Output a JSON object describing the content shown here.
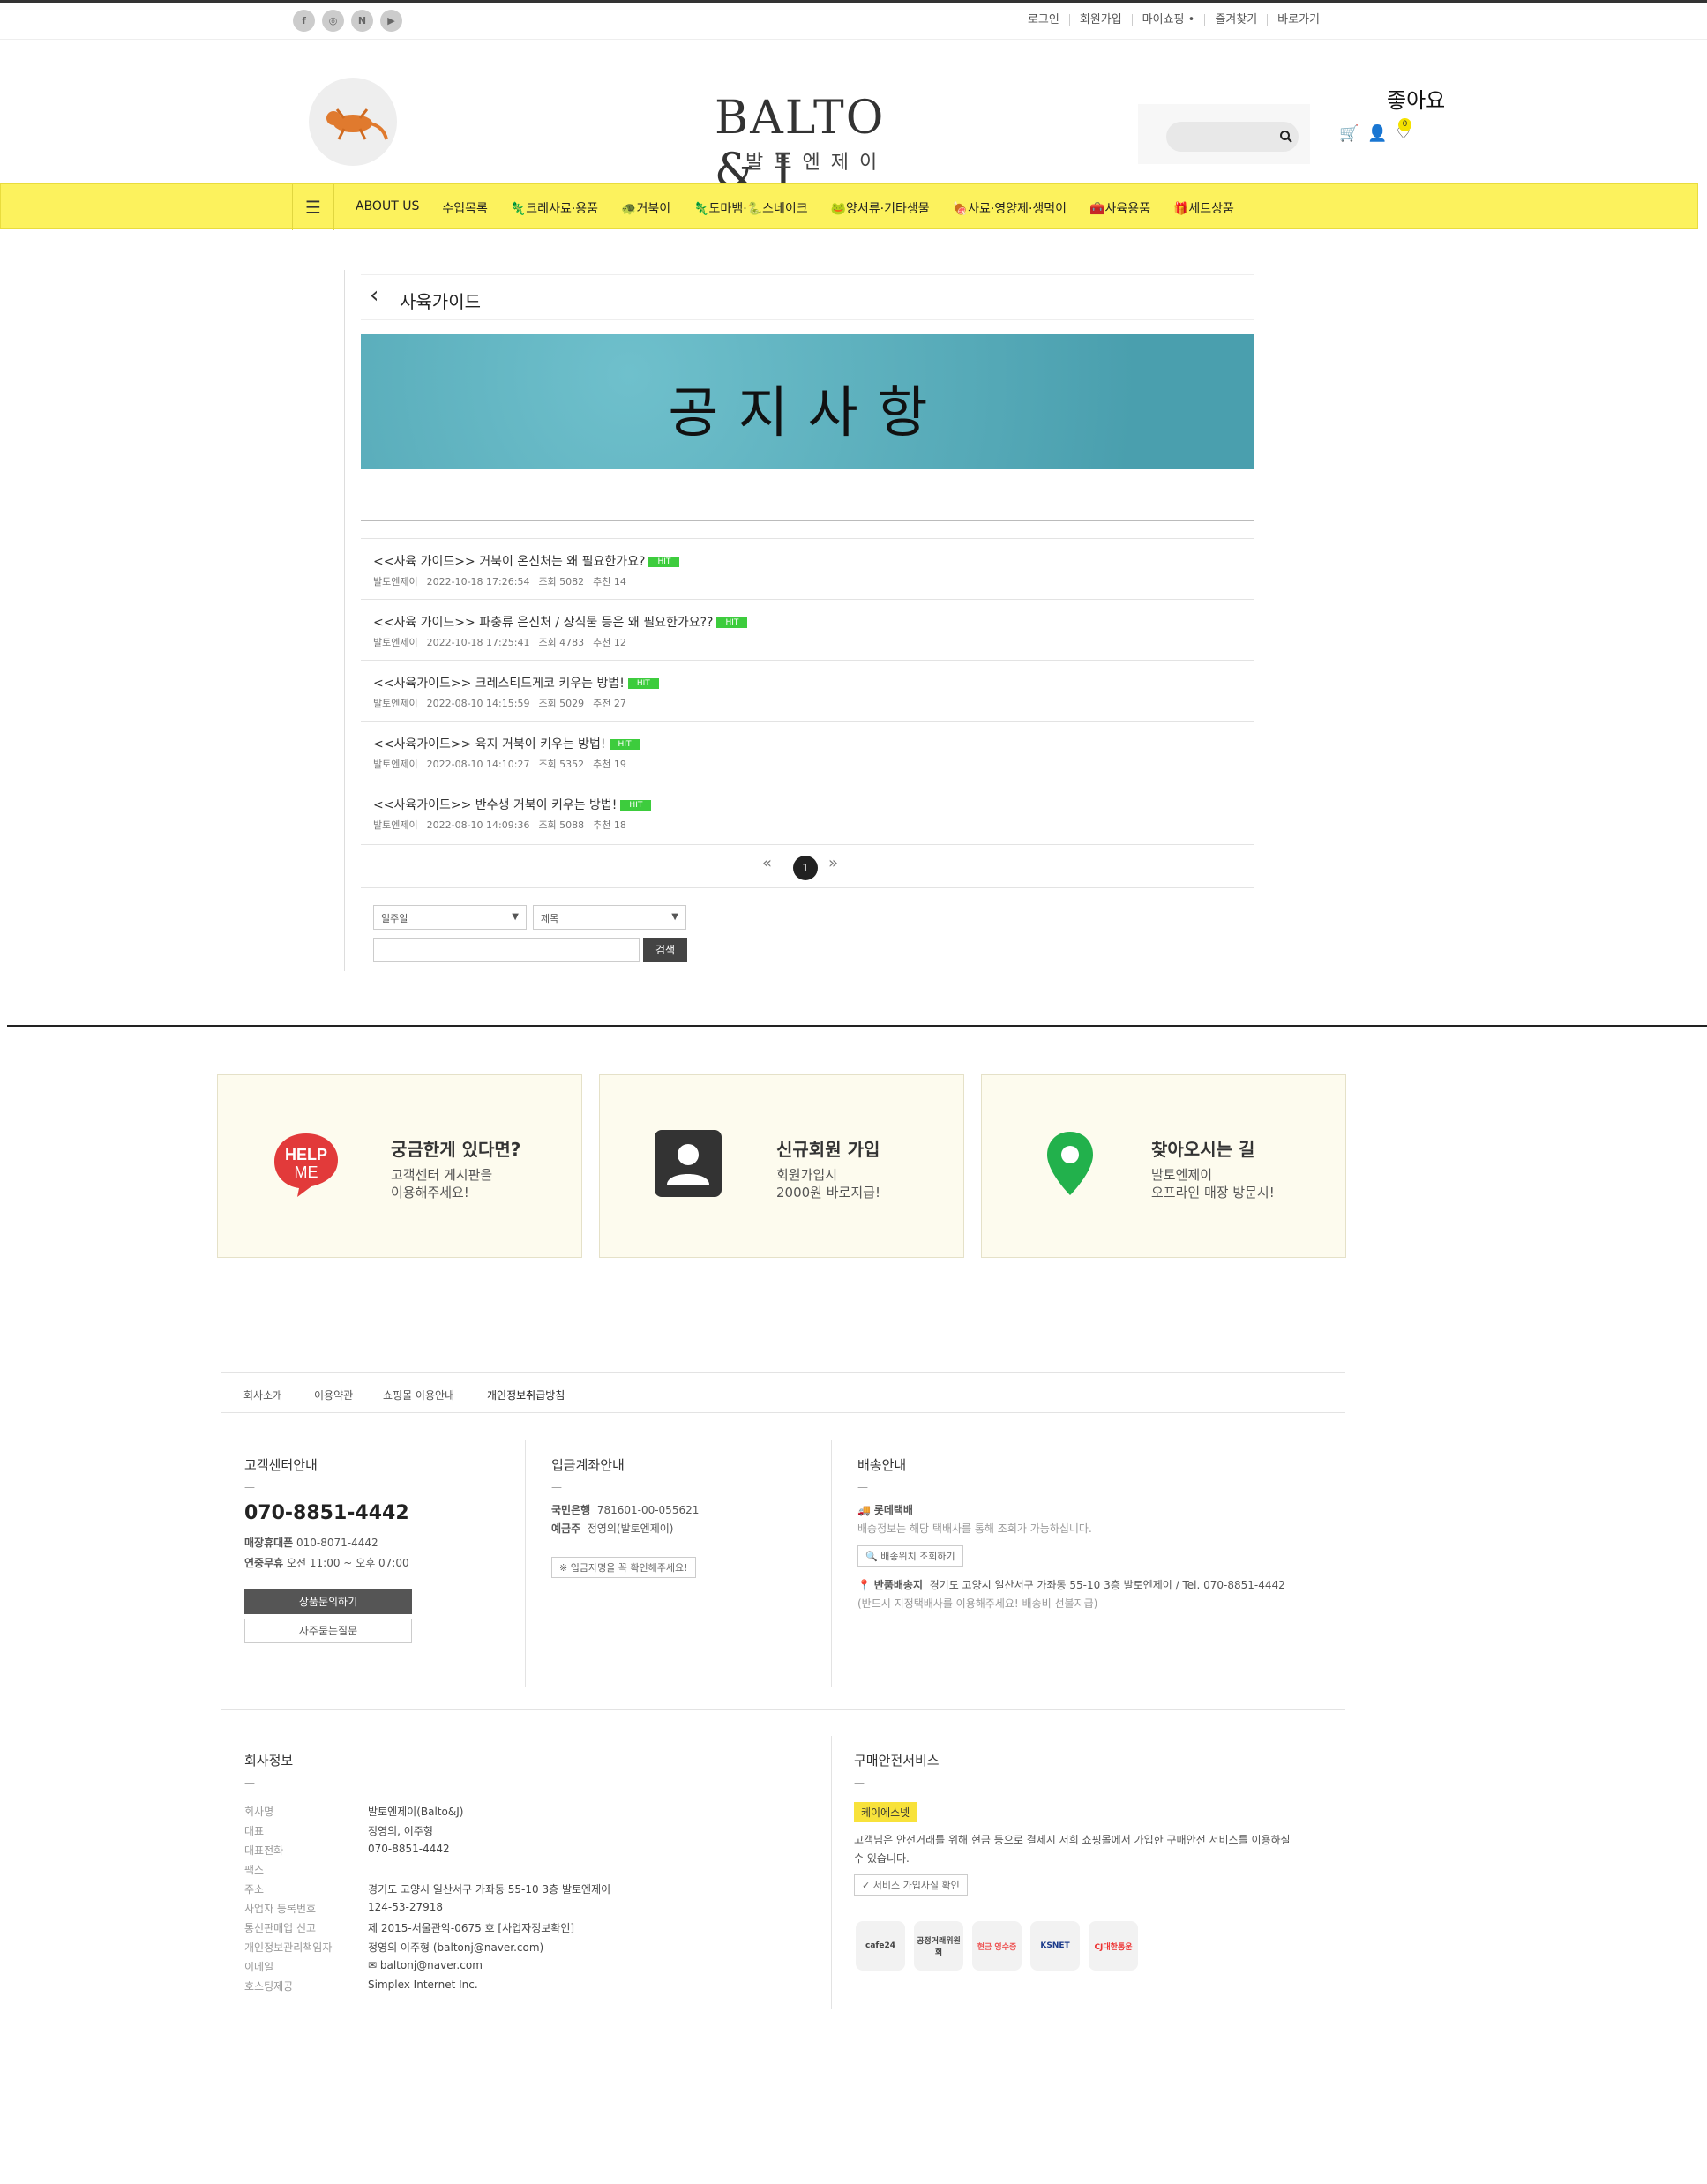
{
  "topbar": {
    "social": [
      "f",
      "◎",
      "N",
      "▶"
    ],
    "links": [
      "로그인",
      "회원가입",
      "마이쇼핑 •",
      "즐겨찾기",
      "바로가기"
    ]
  },
  "header": {
    "logo_main": "BALTO & J",
    "logo_sub": "발토엔제이",
    "likes": "좋아요",
    "cart_badge": "0"
  },
  "nav": {
    "items": [
      "ABOUT US",
      "수입목록",
      "🦎크레사료·용품",
      "🐢거북이",
      "🦎도마뱀·🐍스네이크",
      "🐸양서류·기타생물",
      "🍖사료·영양제·생먹이",
      "🧰사육용품",
      "🎁세트상품"
    ]
  },
  "board": {
    "title": "사육가이드",
    "banner_text": "공지사항",
    "posts": [
      {
        "title": "<<사육 가이드>> 거북이 온신처는 왜 필요한가요?",
        "hit": "HIT",
        "author": "발토엔제이",
        "date": "2022-10-18 17:26:54",
        "views": "조회 5082",
        "recommend": "추천 14"
      },
      {
        "title": "<<사육 가이드>> 파충류 은신처 / 장식물 등은 왜 필요한가요??",
        "hit": "HIT",
        "author": "발토엔제이",
        "date": "2022-10-18 17:25:41",
        "views": "조회 4783",
        "recommend": "추천 12"
      },
      {
        "title": "<<사육가이드>> 크레스티드게코 키우는 방법!",
        "hit": "HIT",
        "author": "발토엔제이",
        "date": "2022-08-10 14:15:59",
        "views": "조회 5029",
        "recommend": "추천 27"
      },
      {
        "title": "<<사육가이드>> 육지 거북이 키우는 방법!",
        "hit": "HIT",
        "author": "발토엔제이",
        "date": "2022-08-10 14:10:27",
        "views": "조회 5352",
        "recommend": "추천 19"
      },
      {
        "title": "<<사육가이드>> 반수생 거북이 키우는 방법!",
        "hit": "HIT",
        "author": "발토엔제이",
        "date": "2022-08-10 14:09:36",
        "views": "조회 5088",
        "recommend": "추천 18"
      }
    ],
    "pager": {
      "prev": "«",
      "current": "1",
      "next": "»"
    },
    "search": {
      "period": "일주일",
      "field": "제목",
      "button": "검색"
    }
  },
  "cards": [
    {
      "icon": "HELP ME",
      "title": "궁금한게 있다면?",
      "line1": "고객센터 게시판을",
      "line2": "이용해주세요!"
    },
    {
      "icon": "user",
      "title": "신규회원 가입",
      "line1": "회원가입시",
      "line2": "2000원 바로지급!"
    },
    {
      "icon": "pin",
      "title": "찾아오시는 길",
      "line1": "발토엔제이",
      "line2": "오프라인 매장 방문시!"
    }
  ],
  "footer": {
    "links": [
      "회사소개",
      "이용약관",
      "쇼핑몰 이용안내",
      "개인정보취급방침"
    ],
    "cs": {
      "title": "고객센터안내",
      "dash": "—",
      "phone": "070-8851-4442",
      "mobile_label": "매장휴대폰",
      "mobile": "010-8071-4442",
      "hours_label": "연중무휴",
      "hours": "오전 11:00 ~ 오후 07:00",
      "btn1": "상품문의하기",
      "btn2": "자주묻는질문"
    },
    "bank": {
      "title": "입금계좌안내",
      "dash": "—",
      "bank_label": "국민은행",
      "account": "781601-00-055621",
      "holder_label": "예금주",
      "holder": "정영의(발토엔제이)",
      "btn": "※ 입금자명을 꼭 확인해주세요!"
    },
    "delivery": {
      "title": "배송안내",
      "dash": "—",
      "carrier": "롯데택배",
      "note": "배송정보는 해당 택배사를 통해 조회가 가능하십니다.",
      "track_btn": "배송위치 조회하기",
      "return_label": "반품배송지",
      "return_addr": "경기도 고양시 일산서구 가좌동 55-10 3층 발토엔제이 / Tel. 070-8851-4442",
      "return_note": "(반드시 지정택배사를 이용해주세요! 배송비 선불지급)"
    },
    "company": {
      "title": "회사정보",
      "dash": "—",
      "rows": [
        {
          "k": "회사명",
          "v": "발토엔제이(Balto&J)"
        },
        {
          "k": "대표",
          "v": "정영의, 이주형"
        },
        {
          "k": "대표전화",
          "v": "070-8851-4442"
        },
        {
          "k": "팩스",
          "v": ""
        },
        {
          "k": "주소",
          "v": "경기도 고양시 일산서구 가좌동 55-10 3층 발토엔제이"
        },
        {
          "k": "사업자 등록번호",
          "v": "124-53-27918"
        },
        {
          "k": "통신판매업 신고",
          "v": "제 2015-서울관악-0675 호 [사업자정보확인]"
        },
        {
          "k": "개인정보관리책임자",
          "v": "정영의 이주형 (baltonj@naver.com)"
        },
        {
          "k": "이메일",
          "v": "✉ baltonj@naver.com"
        },
        {
          "k": "호스팅제공",
          "v": "Simplex Internet Inc."
        }
      ]
    },
    "safety": {
      "title": "구매안전서비스",
      "dash": "—",
      "badge": "케이에스넷",
      "desc1": "고객님은 안전거래를 위해 현금 등으로 결제시 저희 쇼핑몰에서 가입한 구매안전 서비스를 이용하실",
      "desc2": "수 있습니다.",
      "btn": "✓ 서비스 가입사실 확인",
      "logos": [
        "cafe24",
        "공정거래위원회",
        "현금 영수증",
        "KSNET",
        "CJ대한통운"
      ]
    }
  }
}
